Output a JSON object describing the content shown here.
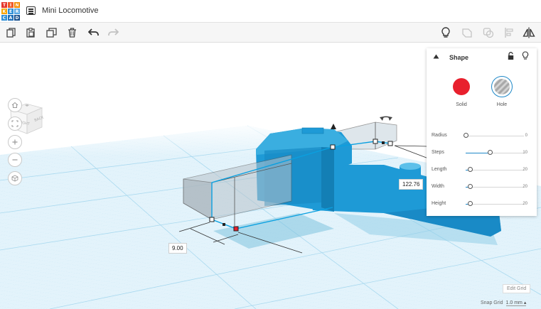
{
  "app": {
    "logo_letters": [
      "T",
      "I",
      "N",
      "K",
      "E",
      "R",
      "C",
      "A",
      "D"
    ],
    "logo_colors": [
      "#e5352b",
      "#f05a28",
      "#f28b00",
      "#f7a400",
      "#2f8fd6",
      "#56a6e3",
      "#2f8fd6",
      "#1d6eb8",
      "#184f8c"
    ]
  },
  "header": {
    "title": "Mini Locomotive",
    "menu_icon": "list-icon"
  },
  "toolbar": {
    "left_icons": [
      "copy-icon",
      "paste-icon",
      "duplicate-icon",
      "delete-icon",
      "undo-icon",
      "redo-icon"
    ],
    "right_icons": [
      "lightbulb-icon",
      "group-icon",
      "ungroup-icon",
      "align-icon",
      "mirror-icon"
    ]
  },
  "viewcube": {
    "front_face": "RIGHT",
    "side_face": "BACK"
  },
  "nav": [
    "home-icon",
    "fit-icon",
    "zoom-in-icon",
    "zoom-out-icon",
    "perspective-icon"
  ],
  "shape_panel": {
    "title": "Shape",
    "solid_label": "Solid",
    "hole_label": "Hole",
    "solid_color": "#e8202d",
    "properties": [
      {
        "label": "Radius",
        "value": "0",
        "fraction": 0.0
      },
      {
        "label": "Steps",
        "value": "10",
        "fraction": 0.42
      },
      {
        "label": "Length",
        "value": "20",
        "fraction": 0.07
      },
      {
        "label": "Width",
        "value": "20",
        "fraction": 0.07
      },
      {
        "label": "Height",
        "value": "20",
        "fraction": 0.07
      }
    ]
  },
  "dimensions": {
    "left": "9.00",
    "right": "122.76"
  },
  "footer": {
    "edit_grid": "Edit Grid",
    "snap_label": "Snap Grid",
    "snap_value": "1.0 mm"
  },
  "colors": {
    "model_blue": "#1e9ad6",
    "grid_blue": "#bfe4f5",
    "accent": "#1e88c8"
  }
}
